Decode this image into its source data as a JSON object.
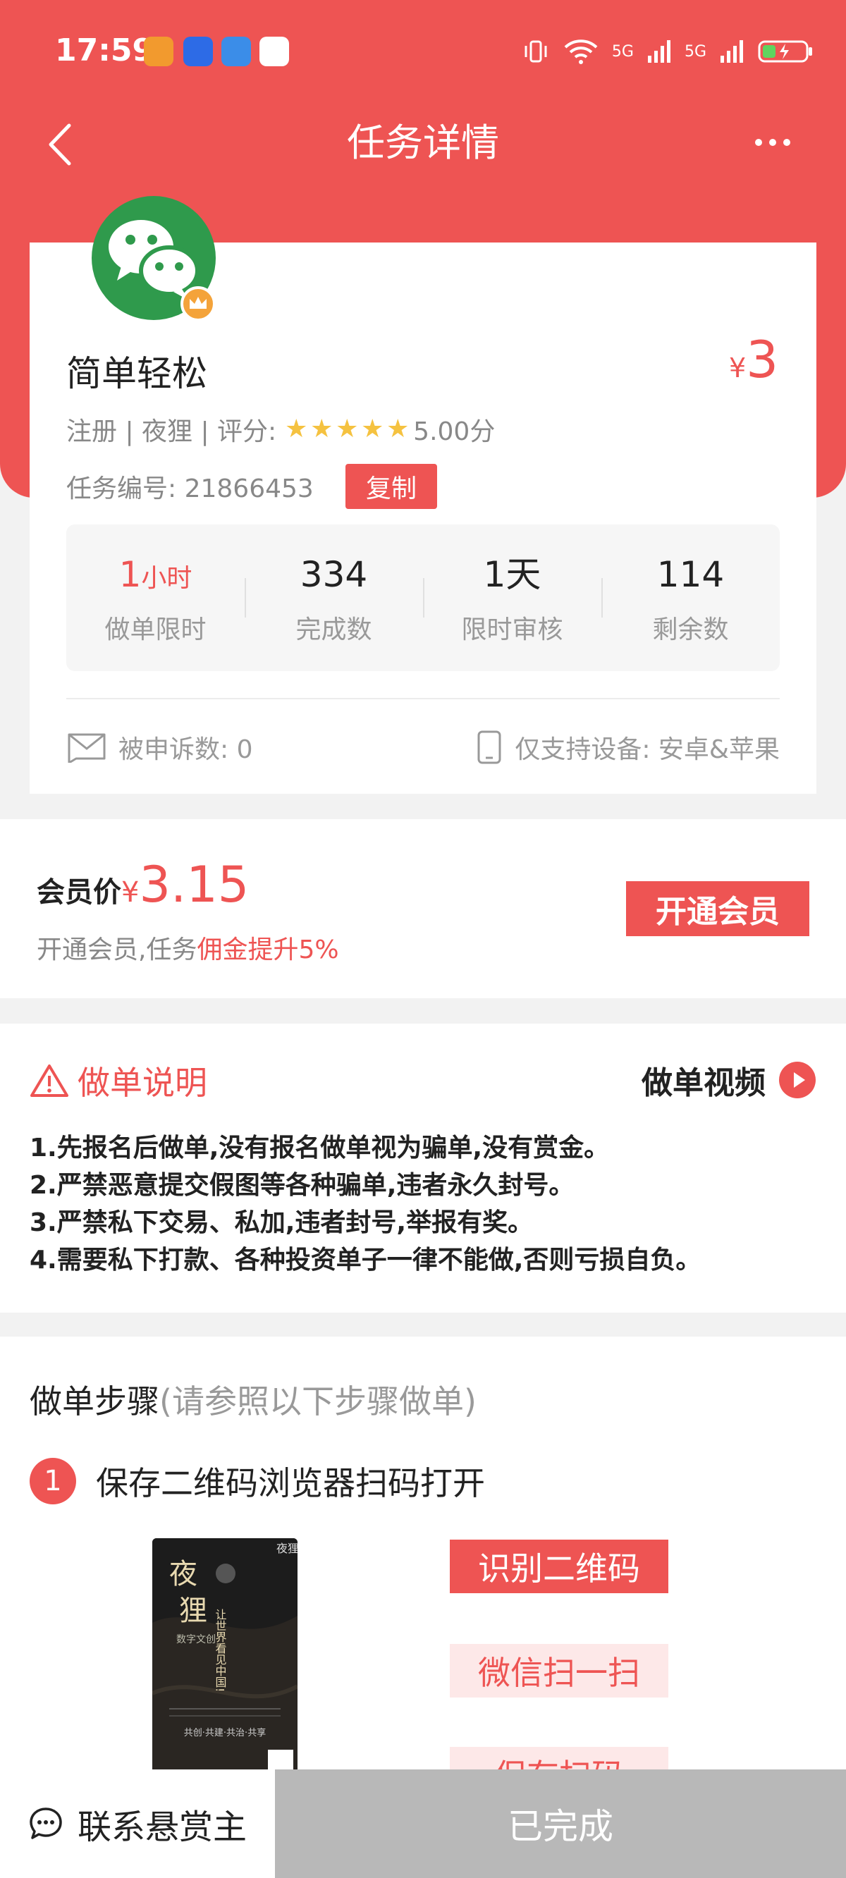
{
  "status_bar": {
    "time": "17:59",
    "signal_1": "5G",
    "signal_2": "5G"
  },
  "header": {
    "title": "任务详情"
  },
  "task": {
    "name": "简单轻松",
    "reward_currency": "¥",
    "reward": "3",
    "meta_prefix": "注册 | 夜狸 | 评分:",
    "rating": "5.00分",
    "rating_stars": 5,
    "id_label": "任务编号: 21866453",
    "copy_label": "复制",
    "stats": [
      {
        "value": "1",
        "unit": "小时",
        "label": "做单限时"
      },
      {
        "value": "334",
        "unit": "",
        "label": "完成数"
      },
      {
        "value": "1天",
        "unit": "",
        "label": "限时审核"
      },
      {
        "value": "114",
        "unit": "",
        "label": "剩余数"
      }
    ],
    "complaints": "被申诉数: 0",
    "devices": "仅支持设备: 安卓&苹果"
  },
  "member": {
    "label": "会员价",
    "currency": "¥",
    "price": "3.15",
    "desc_prefix": "开通会员,任务",
    "desc_highlight": "佣金提升5%",
    "button": "开通会员"
  },
  "instructions": {
    "title": "做单说明",
    "video_label": "做单视频",
    "rules": [
      "1.先报名后做单,没有报名做单视为骗单,没有赏金。",
      "2.严禁恶意提交假图等各种骗单,违者永久封号。",
      "3.严禁私下交易、私加,违者封号,举报有奖。",
      "4.需要私下打款、各种投资单子一律不能做,否则亏损自负。"
    ]
  },
  "steps": {
    "title": "做单步骤",
    "subtitle": "(请参照以下步骤做单)",
    "step1_num": "1",
    "step1_text": "保存二维码浏览器扫码打开",
    "poster_brand": "夜狸",
    "poster_title_1": "夜",
    "poster_title_2": "狸",
    "poster_sub": "数字文创",
    "poster_slogan": "让世界看见中国!",
    "poster_footer": "共创·共建·共治·共享",
    "btn_scan": "识别二维码",
    "btn_wechat": "微信扫一扫",
    "btn_save": "保存扫码"
  },
  "bottom_bar": {
    "contact": "联系悬赏主",
    "status": "已完成"
  },
  "colors": {
    "accent": "#ee5453",
    "wechat_green": "#2f9a4c",
    "disabled": "#b8b8b8"
  }
}
